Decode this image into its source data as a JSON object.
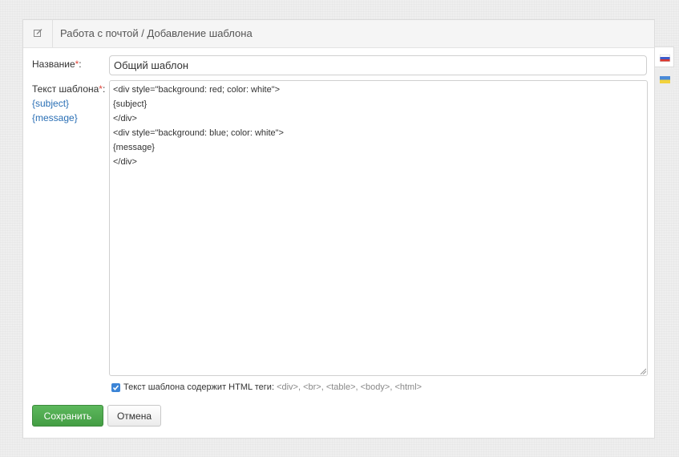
{
  "header": {
    "title": "Работа с почтой / Добавление шаблона",
    "icon": "edit-icon"
  },
  "form": {
    "name_label": "Название",
    "required_mark": "*",
    "label_colon": ":",
    "name_value": "Общий шаблон",
    "text_label": "Текст шаблона",
    "variables": [
      "{subject}",
      "{message}"
    ],
    "template_lines": [
      "<div style=\"background: red; color: white\">",
      "{subject}",
      "</div>",
      "<div style=\"background: blue; color: white\">",
      "{message}",
      "</div>"
    ],
    "html_checkbox": {
      "checked": true,
      "label": "Текст шаблона содержит HTML теги:",
      "tags": "<div>, <br>, <table>, <body>, <html>"
    }
  },
  "buttons": {
    "save": "Сохранить",
    "cancel": "Отмена"
  },
  "colors": {
    "accent_blue": "#2a6fb5",
    "save_green": "#5cb85c",
    "required_red": "#e04a3f",
    "checkbox_blue": "#3b84d6"
  },
  "languages": [
    {
      "code": "ru",
      "icon": "russia-flag-icon",
      "active": true
    },
    {
      "code": "ua",
      "icon": "ukraine-flag-icon",
      "active": false
    }
  ]
}
